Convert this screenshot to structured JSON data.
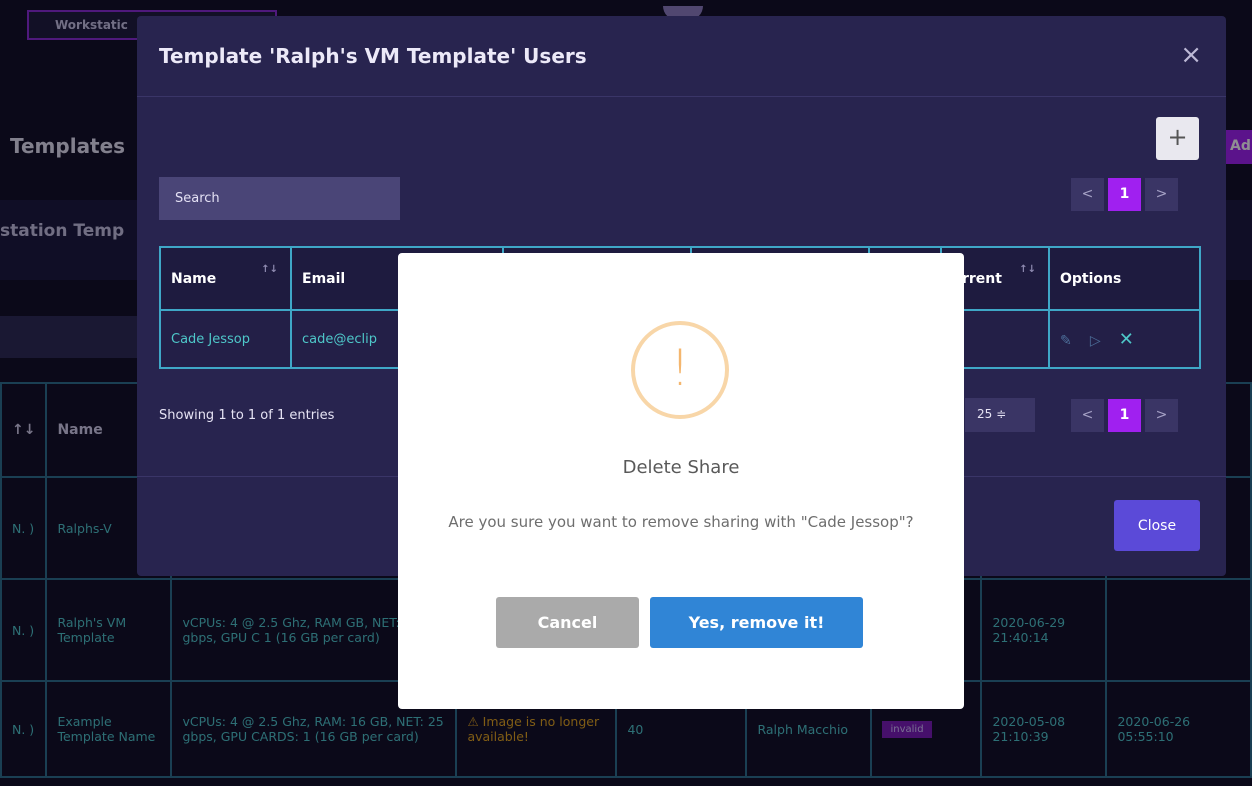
{
  "background": {
    "tab_label": "Workstatic",
    "heading": "Templates",
    "add_label": "Ad",
    "subtitle": "station Temp",
    "table": {
      "header": [
        "↑↓",
        "Name"
      ],
      "rows": [
        {
          "c0": "N.\n)",
          "name": "Ralphs-V"
        },
        {
          "c0": "N.\n)",
          "name": "Ralph's VM Template",
          "specs": "vCPUs: 4 @ 2.5 Ghz, RAM GB, NET: 25 gbps, GPU C 1 (16 GB per card)",
          "created": "2020-06-29 21:40:14"
        },
        {
          "c0": "N.\n)",
          "name": "Example Template Name",
          "specs": "vCPUs: 4 @ 2.5 Ghz, RAM: 16 GB, NET: 25 gbps, GPU CARDS: 1 (16 GB per card)",
          "image": "⚠ Image is no longer available!",
          "count": "40",
          "owner": "Ralph Macchio",
          "status": "invalid",
          "created": "2020-05-08 21:10:39",
          "updated": "2020-06-26 05:55:10"
        }
      ]
    }
  },
  "modal": {
    "title": "Template 'Ralph's VM Template' Users",
    "close_glyph": "×",
    "add_glyph": "+",
    "search_placeholder": "Search",
    "pager": {
      "prev": "<",
      "page": "1",
      "next": ">"
    },
    "columns": [
      "Name",
      "Email",
      "",
      "",
      "",
      "urrent",
      "Options"
    ],
    "rows": [
      {
        "name": "Cade Jessop",
        "email": "cade@eclip"
      }
    ],
    "showing": "Showing 1 to 1 of 1 entries",
    "page_length": "25 ≑",
    "close_label": "Close"
  },
  "confirm": {
    "icon": "!",
    "title": "Delete Share",
    "text": "Are you sure you want to remove sharing with \"Cade Jessop\"?",
    "cancel_label": "Cancel",
    "confirm_label": "Yes, remove it!"
  },
  "colors": {
    "accent": "#a020f0",
    "table_border": "#3fa7c7",
    "confirm_button": "#3085d6",
    "warning": "#f4b66e"
  }
}
